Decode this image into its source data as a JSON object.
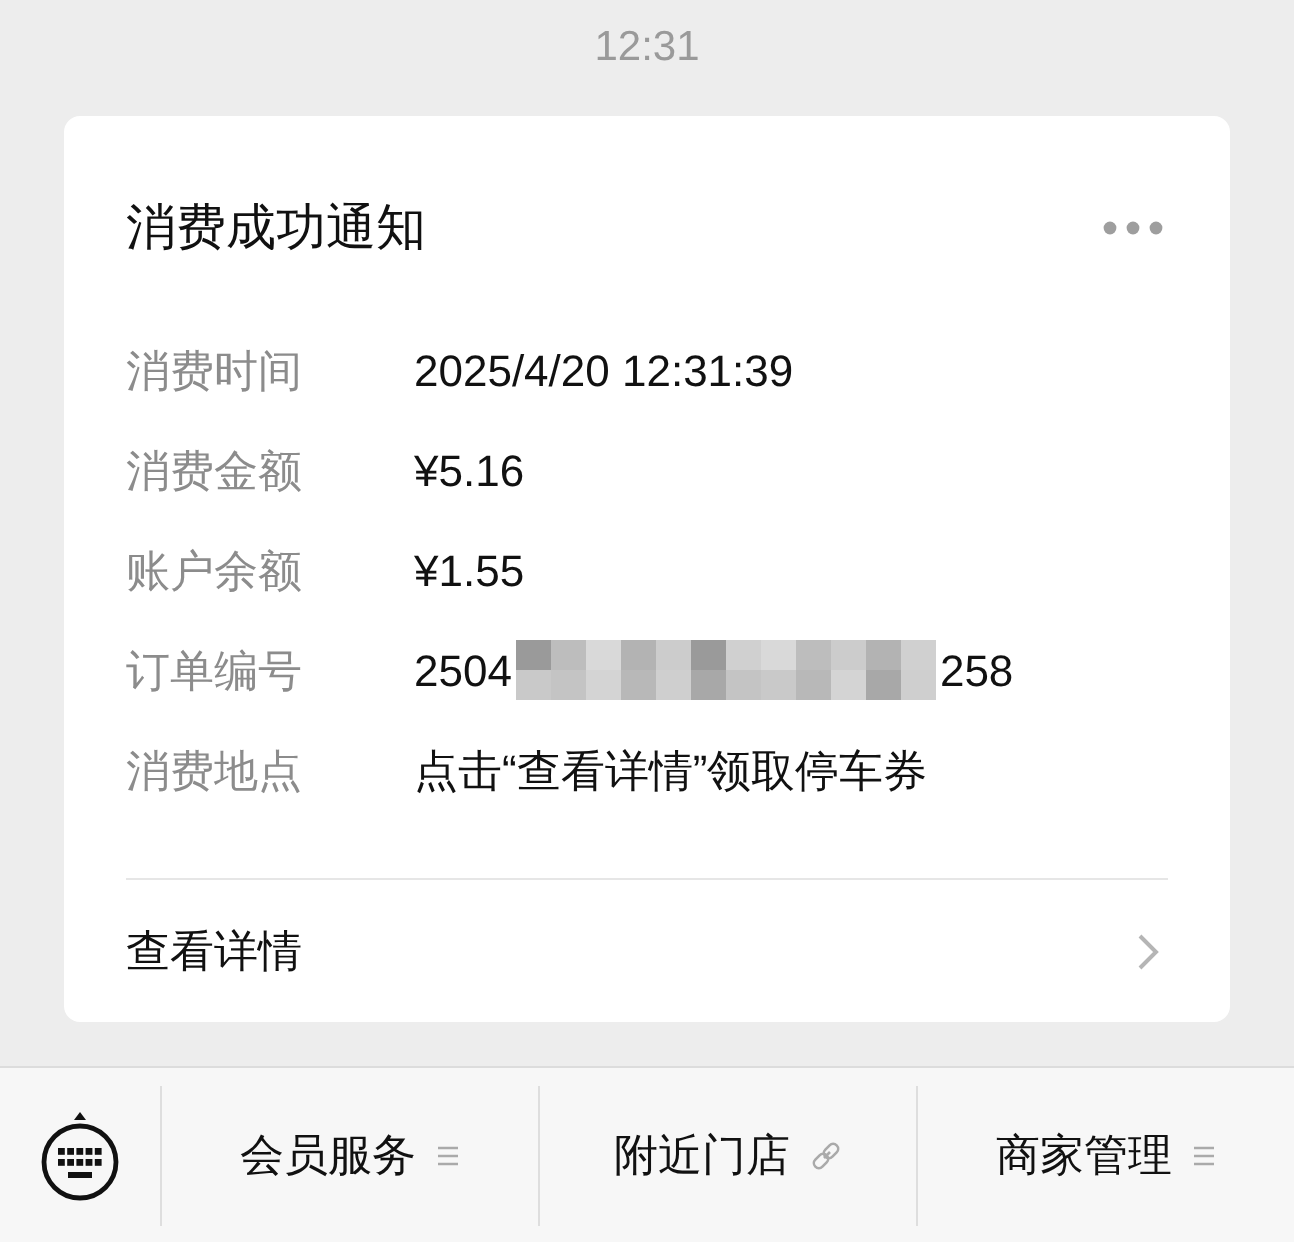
{
  "timestamp": "12:31",
  "card": {
    "title": "消费成功通知",
    "fields": [
      {
        "label": "消费时间",
        "parts": [
          {
            "kind": "text",
            "text": "2025/4/20 12:31:39"
          }
        ]
      },
      {
        "label": "消费金额",
        "parts": [
          {
            "kind": "text",
            "text": "¥5.16"
          }
        ]
      },
      {
        "label": "账户余额",
        "parts": [
          {
            "kind": "text",
            "text": "¥1.55"
          }
        ]
      },
      {
        "label": "订单编号",
        "parts": [
          {
            "kind": "text",
            "text": "2504"
          },
          {
            "kind": "redacted"
          },
          {
            "kind": "text",
            "text": "258"
          }
        ]
      },
      {
        "label": "消费地点",
        "parts": [
          {
            "kind": "text",
            "text": "点击“查看详情”领取停车券"
          }
        ]
      }
    ],
    "link": "查看详情"
  },
  "menu": [
    {
      "label": "会员服务",
      "kind": "list"
    },
    {
      "label": "附近门店",
      "kind": "link"
    },
    {
      "label": "商家管理",
      "kind": "list"
    }
  ]
}
